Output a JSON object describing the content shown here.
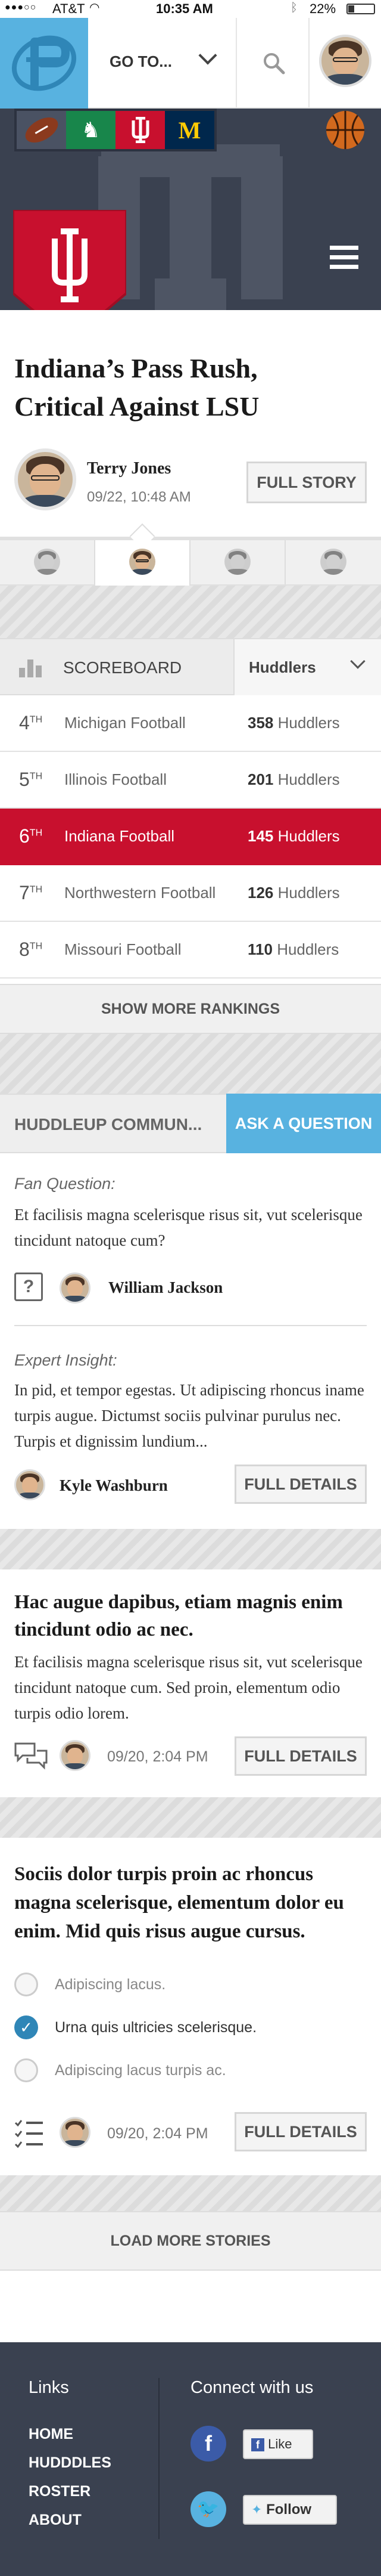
{
  "status_bar": {
    "carrier": "AT&T",
    "time": "10:35 AM",
    "battery": "22%"
  },
  "header": {
    "goto_label": "GO TO..."
  },
  "team_tabs": [
    "football",
    "michigan-state",
    "indiana",
    "michigan",
    "basketball"
  ],
  "hero": {
    "title": "Indiana’s Pass Rush, Critical Against LSU",
    "author": "Terry Jones",
    "date": "09/22, 10:48 AM",
    "full_story_label": "FULL STORY"
  },
  "scoreboard": {
    "title": "SCOREBOARD",
    "filter_label": "Huddlers",
    "rows": [
      {
        "rank": "4",
        "suffix": "TH",
        "team": "Michigan Football",
        "count": "358",
        "unit": "Huddlers",
        "active": false
      },
      {
        "rank": "5",
        "suffix": "TH",
        "team": "Illinois Football",
        "count": "201",
        "unit": "Huddlers",
        "active": false
      },
      {
        "rank": "6",
        "suffix": "TH",
        "team": "Indiana Football",
        "count": "145",
        "unit": "Huddlers",
        "active": true
      },
      {
        "rank": "7",
        "suffix": "TH",
        "team": "Northwestern Football",
        "count": "126",
        "unit": "Huddlers",
        "active": false
      },
      {
        "rank": "8",
        "suffix": "TH",
        "team": "Missouri Football",
        "count": "110",
        "unit": "Huddlers",
        "active": false
      }
    ],
    "show_more_label": "SHOW MORE RANKINGS"
  },
  "community": {
    "tab_label": "HUDDLEUP COMMUN...",
    "ask_label": "ASK A QUESTION",
    "fan_label": "Fan Question:",
    "fan_text": "Et facilisis magna scelerisque risus sit, vut scelerisque tincidunt natoque cum?",
    "fan_author": "William Jackson",
    "expert_label": "Expert Insight:",
    "expert_text": "In pid, et tempor egestas. Ut adipiscing rhoncus iname turpis augue. Dictumst sociis pulvinar purulus nec. Turpis et dignissim lundium...",
    "expert_author": "Kyle Washburn",
    "details_label": "FULL DETAILS"
  },
  "story": {
    "title": "Hac augue dapibus, etiam magnis enim tincidunt odio ac nec.",
    "text": "Et facilisis magna scelerisque risus sit, vut scelerisque tincidunt natoque cum. Sed proin, elementum odio turpis odio lorem.",
    "date": "09/20, 2:04 PM",
    "details_label": "FULL DETAILS"
  },
  "poll": {
    "title": "Sociis dolor turpis proin ac rhoncus magna scelerisque, elementum dolor eu enim. Mid quis risus augue cursus.",
    "options": [
      {
        "label": "Adipiscing lacus.",
        "selected": false
      },
      {
        "label": "Urna quis ultricies scelerisque.",
        "selected": true
      },
      {
        "label": "Adipiscing lacus turpis ac.",
        "selected": false
      }
    ],
    "date": "09/20, 2:04 PM",
    "details_label": "FULL DETAILS"
  },
  "load_more_label": "LOAD MORE STORIES",
  "footer": {
    "links_title": "Links",
    "links": [
      "HOME",
      "HUDDDLES",
      "ROSTER",
      "ABOUT"
    ],
    "connect_title": "Connect with us",
    "like_label": "Like",
    "follow_label": "Follow"
  },
  "colors": {
    "navy": "#3a4150",
    "crimson": "#c8102e",
    "blue": "#58b2e0",
    "green": "#18864b",
    "mich_blue": "#00274c",
    "maize": "#ffcb05"
  }
}
